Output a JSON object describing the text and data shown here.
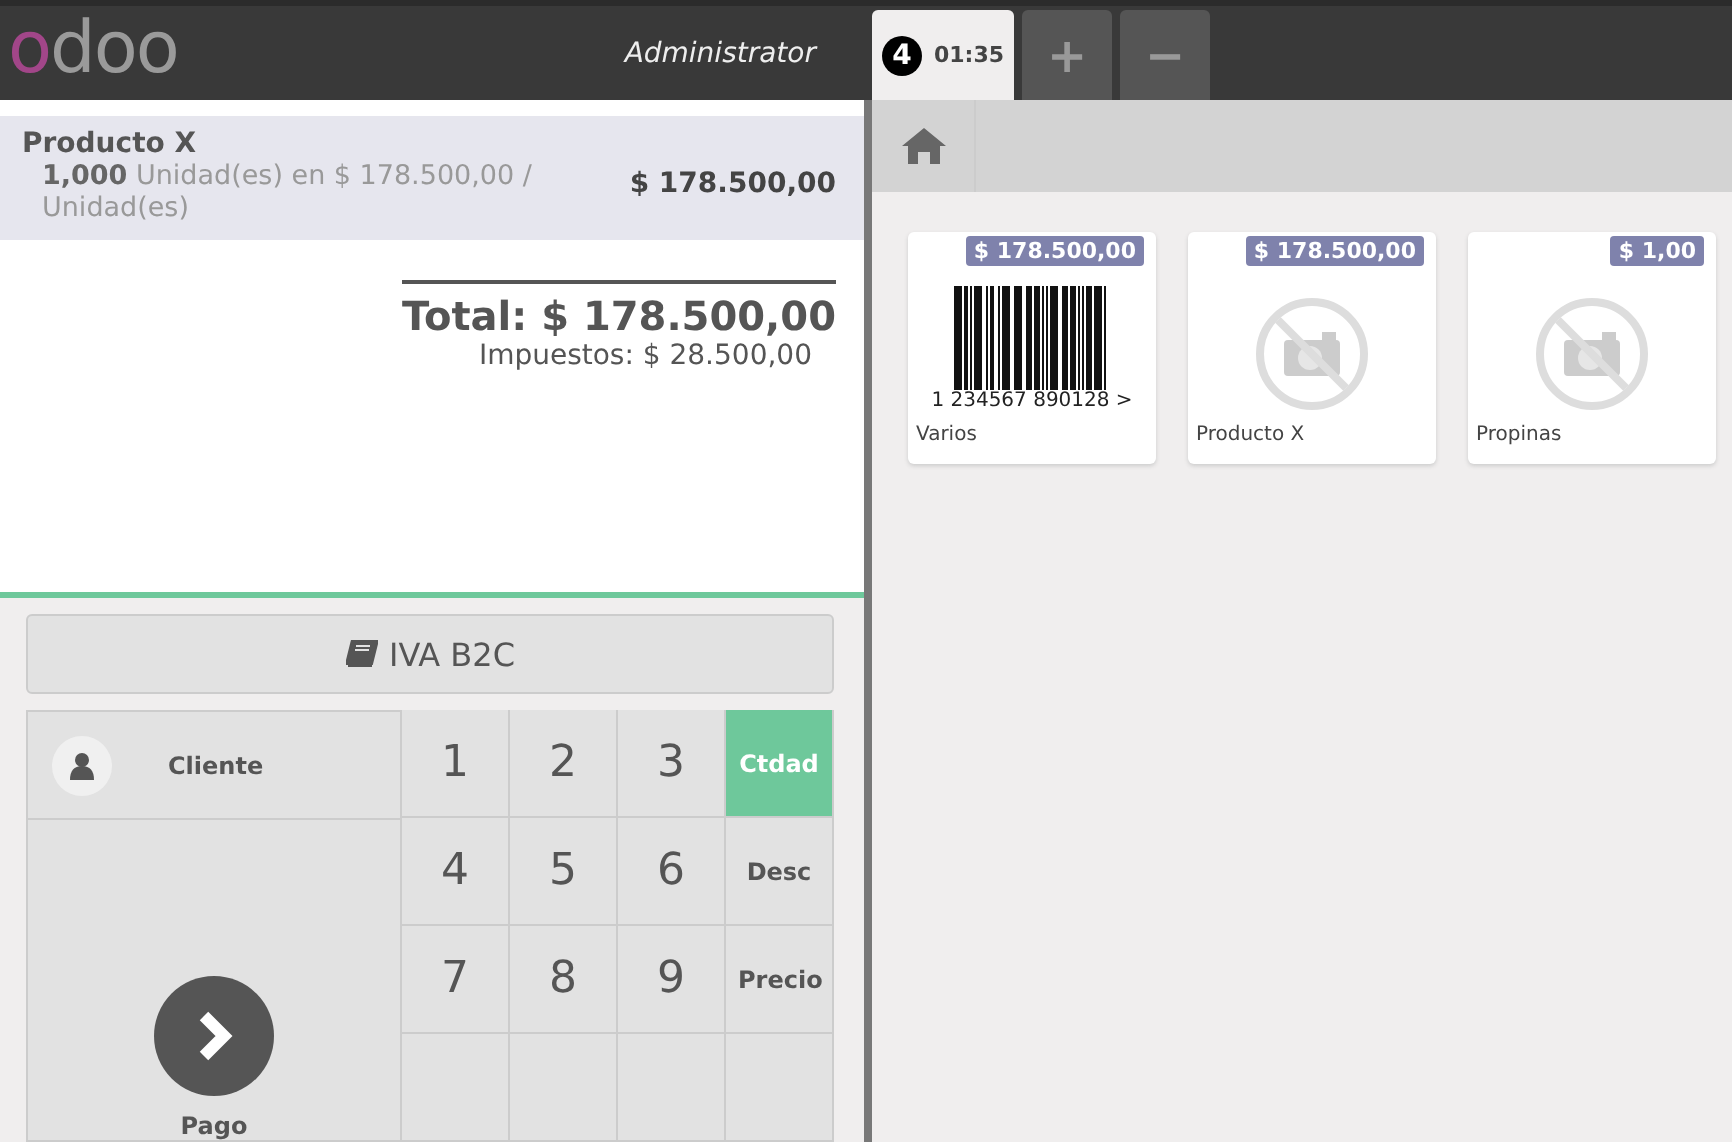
{
  "header": {
    "logo": "odoo",
    "user": "Administrator",
    "order_tabs": [
      {
        "badge": "4",
        "time": "01:35",
        "selected": true
      }
    ],
    "add_button": "+",
    "remove_button": "−"
  },
  "order": {
    "lines": [
      {
        "product": "Producto X",
        "quantity": "1,000",
        "detail": "Unidad(es) en $ 178.500,00 / Unidad(es)",
        "price": "$ 178.500,00",
        "selected": true
      }
    ],
    "total": "Total: $ 178.500,00",
    "taxes": "Impuestos: $ 28.500,00"
  },
  "fiscal_position": "IVA B2C",
  "customer": "Cliente",
  "payment": "Pago",
  "numpad": [
    [
      "1",
      "2",
      "3"
    ],
    [
      "4",
      "5",
      "6"
    ],
    [
      "7",
      "8",
      "9"
    ]
  ],
  "modes": [
    {
      "label": "Ctdad",
      "selected": true
    },
    {
      "label": "Desc",
      "selected": false
    },
    {
      "label": "Precio",
      "selected": false
    }
  ],
  "products": [
    {
      "name": "Varios",
      "price": "$ 178.500,00",
      "kind": "barcode",
      "image_text": "1 234567 890128 >"
    },
    {
      "name": "Producto X",
      "price": "$ 178.500,00",
      "kind": "no-image"
    },
    {
      "name": "Propinas",
      "price": "$ 1,00",
      "kind": "no-image"
    }
  ]
}
